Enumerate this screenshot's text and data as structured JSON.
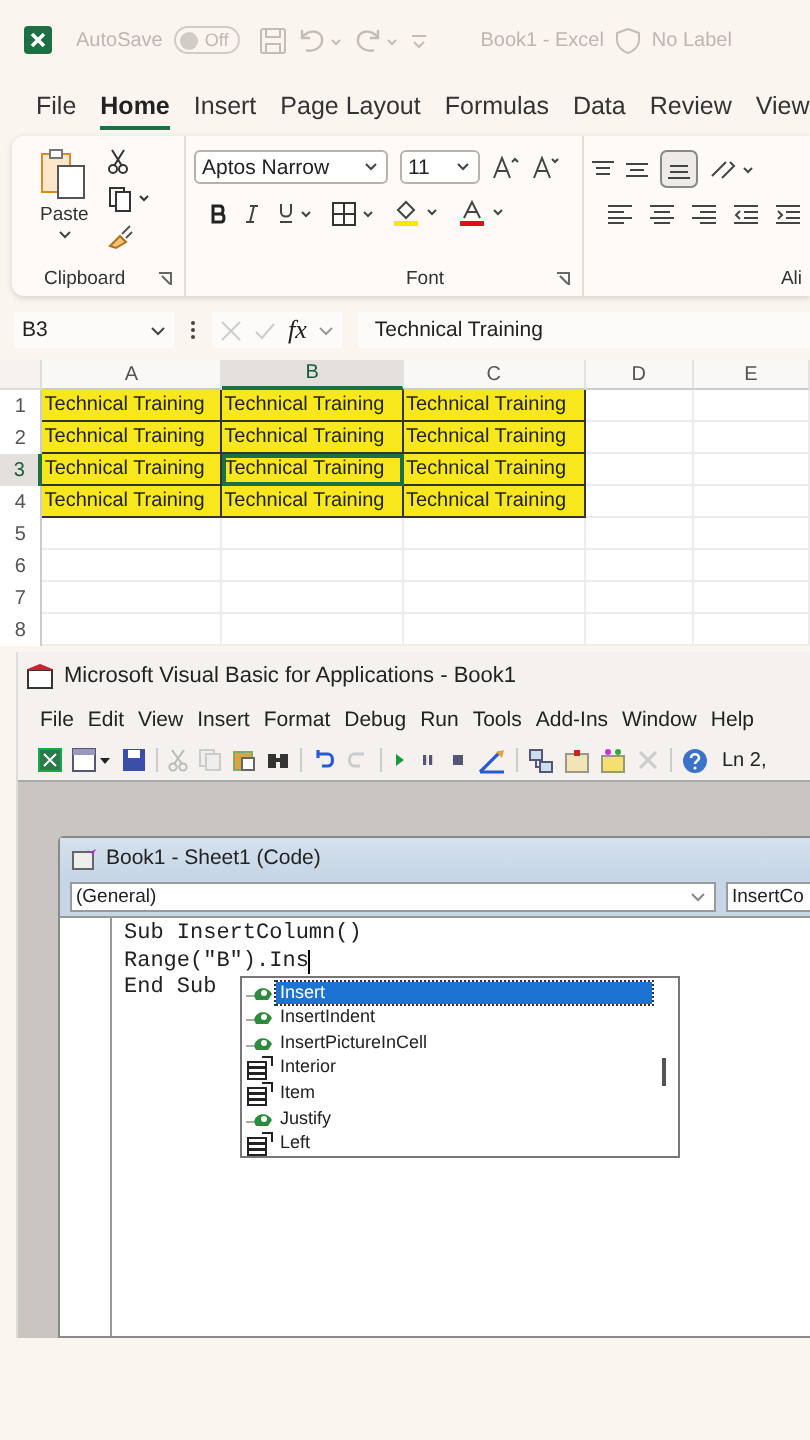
{
  "title_bar": {
    "autosave": {
      "label": "AutoSave",
      "on": false,
      "state_text": "Off"
    },
    "document_title": "Book1 - Excel",
    "sensitivity": "No Label"
  },
  "ribbon": {
    "tabs": [
      {
        "label": "File",
        "selected": false
      },
      {
        "label": "Home",
        "selected": true
      },
      {
        "label": "Insert",
        "selected": false
      },
      {
        "label": "Page Layout",
        "selected": false
      },
      {
        "label": "Formulas",
        "selected": false
      },
      {
        "label": "Data",
        "selected": false
      },
      {
        "label": "Review",
        "selected": false
      },
      {
        "label": "View",
        "selected": false
      }
    ],
    "clipboard": {
      "paste_label": "Paste",
      "group_label": "Clipboard"
    },
    "font": {
      "font_name": "Aptos Narrow",
      "font_size": "11",
      "group_label": "Font"
    },
    "alignment": {
      "group_label": "Ali"
    }
  },
  "formula_bar": {
    "name_box": "B3",
    "function_label": "fx",
    "value": "Technical Training"
  },
  "sheet": {
    "columns": [
      {
        "label": "A",
        "selected": false
      },
      {
        "label": "B",
        "selected": true
      },
      {
        "label": "C",
        "selected": false
      },
      {
        "label": "D",
        "selected": false
      },
      {
        "label": "E",
        "selected": false
      }
    ],
    "rows": [
      {
        "label": "1",
        "selected": false,
        "cells": [
          {
            "text": "Technical Training",
            "highlighted": true,
            "selected": false
          },
          {
            "text": "Technical Training",
            "highlighted": true,
            "selected": false
          },
          {
            "text": "Technical Training",
            "highlighted": true,
            "selected": false
          }
        ]
      },
      {
        "label": "2",
        "selected": false,
        "cells": [
          {
            "text": "Technical Training",
            "highlighted": true,
            "selected": false
          },
          {
            "text": "Technical Training",
            "highlighted": true,
            "selected": false
          },
          {
            "text": "Technical Training",
            "highlighted": true,
            "selected": false
          }
        ]
      },
      {
        "label": "3",
        "selected": true,
        "cells": [
          {
            "text": "Technical Training",
            "highlighted": true,
            "selected": false
          },
          {
            "text": "Technical Training",
            "highlighted": true,
            "selected": true
          },
          {
            "text": "Technical Training",
            "highlighted": true,
            "selected": false
          }
        ]
      },
      {
        "label": "4",
        "selected": false,
        "cells": [
          {
            "text": "Technical Training",
            "highlighted": true,
            "selected": false
          },
          {
            "text": "Technical Training",
            "highlighted": true,
            "selected": false
          },
          {
            "text": "Technical Training",
            "highlighted": true,
            "selected": false
          }
        ]
      },
      {
        "label": "5",
        "selected": false,
        "cells": []
      },
      {
        "label": "6",
        "selected": false,
        "cells": []
      },
      {
        "label": "7",
        "selected": false,
        "cells": []
      },
      {
        "label": "8",
        "selected": false,
        "cells": []
      }
    ]
  },
  "vba_window": {
    "title": "Microsoft Visual Basic for Applications - Book1",
    "menu": [
      "File",
      "Edit",
      "View",
      "Insert",
      "Format",
      "Debug",
      "Run",
      "Tools",
      "Add-Ins",
      "Window",
      "Help"
    ],
    "toolbar_status": "Ln 2,",
    "code_window": {
      "title": "Book1 - Sheet1 (Code)",
      "object_dropdown": "(General)",
      "procedure_dropdown": "InsertCo",
      "lines": [
        "Sub InsertColumn()",
        "Range(\"B\").Ins",
        "End Sub"
      ],
      "autocomplete": [
        {
          "label": "Insert",
          "kind": "method",
          "selected": true
        },
        {
          "label": "InsertIndent",
          "kind": "method",
          "selected": false
        },
        {
          "label": "InsertPictureInCell",
          "kind": "method",
          "selected": false
        },
        {
          "label": "Interior",
          "kind": "property",
          "selected": false
        },
        {
          "label": "Item",
          "kind": "property",
          "selected": false
        },
        {
          "label": "Justify",
          "kind": "method",
          "selected": false
        },
        {
          "label": "Left",
          "kind": "property",
          "selected": false
        }
      ]
    }
  }
}
